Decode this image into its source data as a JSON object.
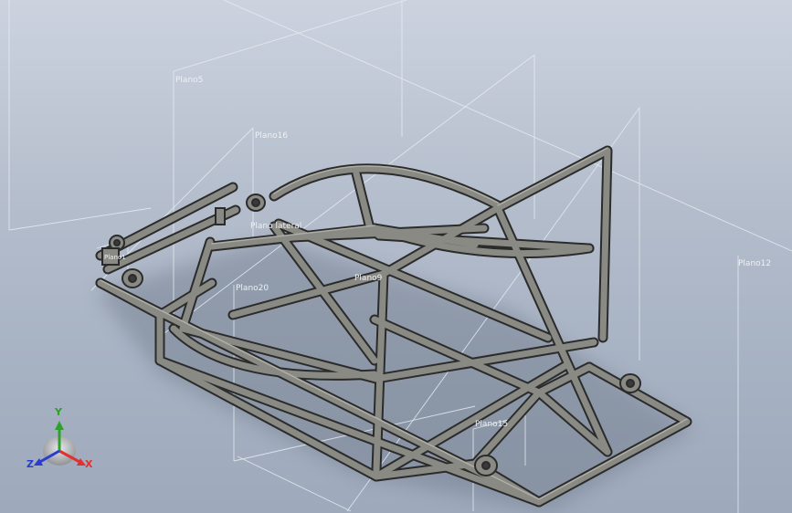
{
  "viewport": {
    "background_top": "#ccd3df",
    "background_bottom": "#9ea9bb"
  },
  "planes": {
    "plano5": "Plano5",
    "plano16": "Plano16",
    "plano20": "Plano20",
    "plano9": "Plano9",
    "plano12": "Plano12",
    "plano15": "Plano15",
    "lateral": "Plano lateral",
    "small": "Plano1"
  },
  "triad": {
    "x_label": "X",
    "y_label": "Y",
    "z_label": "Z",
    "x_color": "#e03030",
    "y_color": "#2ea02e",
    "z_color": "#2a3bd0"
  },
  "colors": {
    "tube_face": "#8a8a84",
    "tube_edge": "#2b2b2b",
    "plane_line": "#e8ecf2"
  }
}
